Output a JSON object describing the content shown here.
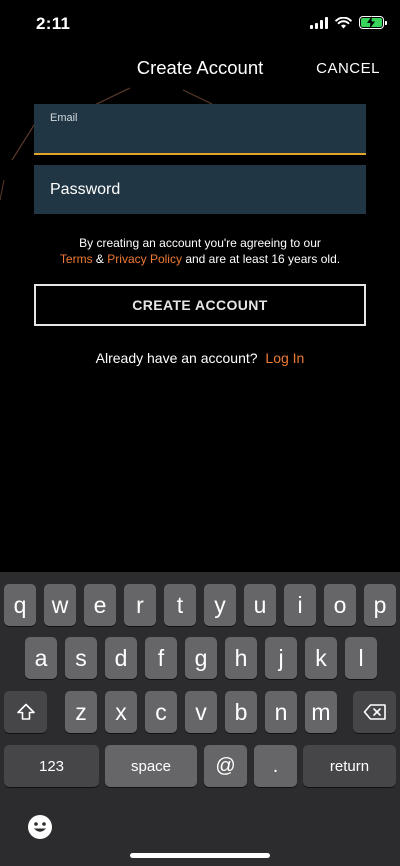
{
  "status": {
    "time": "2:11"
  },
  "header": {
    "title": "Create Account",
    "cancel": "CANCEL"
  },
  "form": {
    "email_label": "Email",
    "email_value": "",
    "password_placeholder": "Password",
    "legal_line1": "By creating an account you're agreeing to our",
    "terms_link": "Terms",
    "amp": "&",
    "privacy_link": "Privacy Policy",
    "legal_tail": "and are at least 16 years old.",
    "create_button": "CREATE ACCOUNT",
    "login_prompt": "Already have an account?",
    "login_link": "Log In"
  },
  "colors": {
    "accent": "#ee7a34",
    "field_bg": "#213644",
    "focus_underline": "#e2a526"
  },
  "keyboard": {
    "row1": [
      "q",
      "w",
      "e",
      "r",
      "t",
      "y",
      "u",
      "i",
      "o",
      "p"
    ],
    "row2": [
      "a",
      "s",
      "d",
      "f",
      "g",
      "h",
      "j",
      "k",
      "l"
    ],
    "row3": [
      "z",
      "x",
      "c",
      "v",
      "b",
      "n",
      "m"
    ],
    "numbers_key": "123",
    "space_key": "space",
    "at_key": "@",
    "dot_key": ".",
    "return_key": "return"
  }
}
